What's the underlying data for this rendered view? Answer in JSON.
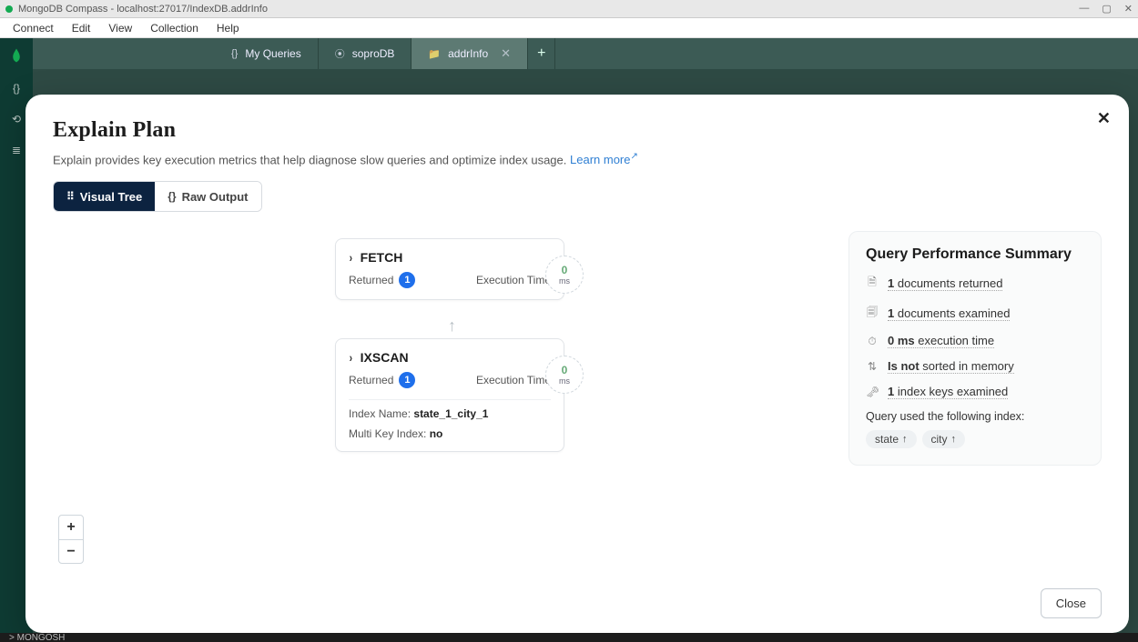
{
  "window": {
    "title": "MongoDB Compass - localhost:27017/IndexDB.addrInfo",
    "controls": {
      "min": "—",
      "max": "▢",
      "close": "✕"
    }
  },
  "menu": [
    "Connect",
    "Edit",
    "View",
    "Collection",
    "Help"
  ],
  "tabs": [
    {
      "icon": "{}",
      "label": "My Queries",
      "active": false,
      "closable": false
    },
    {
      "icon": "⦿",
      "label": "soproDB",
      "active": false,
      "closable": false
    },
    {
      "icon": "📁",
      "label": "addrInfo",
      "active": true,
      "closable": true
    }
  ],
  "modal": {
    "title": "Explain Plan",
    "subtitle": "Explain provides key execution metrics that help diagnose slow queries and optimize index usage.",
    "learn_more": "Learn more",
    "view": {
      "visual": "Visual Tree",
      "raw": "Raw Output"
    },
    "stages": {
      "fetch": {
        "name": "FETCH",
        "returned_label": "Returned",
        "returned": "1",
        "exec_label": "Execution Time",
        "ms_num": "0",
        "ms_unit": "ms"
      },
      "ixscan": {
        "name": "IXSCAN",
        "returned_label": "Returned",
        "returned": "1",
        "exec_label": "Execution Time",
        "ms_num": "0",
        "ms_unit": "ms",
        "index_name_label": "Index Name:",
        "index_name": "state_1_city_1",
        "multikey_label": "Multi Key Index:",
        "multikey": "no"
      }
    },
    "summary": {
      "title": "Query Performance Summary",
      "docs_returned_val": "1",
      "docs_returned_text": "documents returned",
      "docs_examined_val": "1",
      "docs_examined_text": "documents examined",
      "exec_time_val": "0 ms",
      "exec_time_text": "execution time",
      "sorted_val": "Is not",
      "sorted_text": "sorted in memory",
      "keys_examined_val": "1",
      "keys_examined_text": "index keys examined",
      "index_used_label": "Query used the following index:",
      "index_chips": [
        {
          "field": "state",
          "dir": "↑"
        },
        {
          "field": "city",
          "dir": "↑"
        }
      ]
    },
    "close": "Close"
  },
  "zoom": {
    "in": "+",
    "out": "−"
  },
  "mongosh": "> MONGOSH"
}
